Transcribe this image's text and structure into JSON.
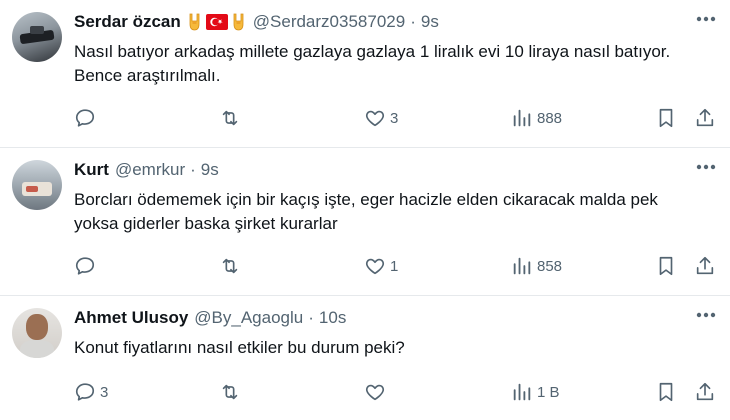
{
  "tweets": [
    {
      "name": "Serdar özcan",
      "handle": "@Serdarz03587029",
      "separator": "·",
      "time": "9s",
      "emojis": [
        "rock-hand-emoji",
        "turkey-flag-emoji",
        "rock-hand-emoji"
      ],
      "text": "Nasıl batıyor arkadaş millete gazlaya gazlaya 1 liralık evi 10 liraya nasıl batıyor. Bence araştırılmalı.",
      "reply_count": "",
      "retweet_count": "",
      "like_count": "3",
      "view_count": "888"
    },
    {
      "name": "Kurt",
      "handle": "@emrkur",
      "separator": "·",
      "time": "9s",
      "emojis": [],
      "text": "Borcları ödememek için bir kaçış işte, eger hacizle elden cikaracak malda pek yoksa giderler baska şirket kurarlar",
      "reply_count": "",
      "retweet_count": "",
      "like_count": "1",
      "view_count": "858"
    },
    {
      "name": "Ahmet Ulusoy",
      "handle": "@By_Agaoglu",
      "separator": "·",
      "time": "10s",
      "emojis": [],
      "text": "Konut fiyatlarını nasıl etkiler bu durum peki?",
      "reply_count": "3",
      "retweet_count": "",
      "like_count": "",
      "view_count": "1 B"
    }
  ],
  "colors": {
    "text_primary": "#0f1419",
    "text_secondary": "#536471",
    "divider": "#e6e9ec",
    "flag_red": "#e30a17"
  },
  "icons": [
    "more-icon",
    "reply-icon",
    "retweet-icon",
    "like-icon",
    "views-icon",
    "bookmark-icon",
    "share-icon"
  ]
}
